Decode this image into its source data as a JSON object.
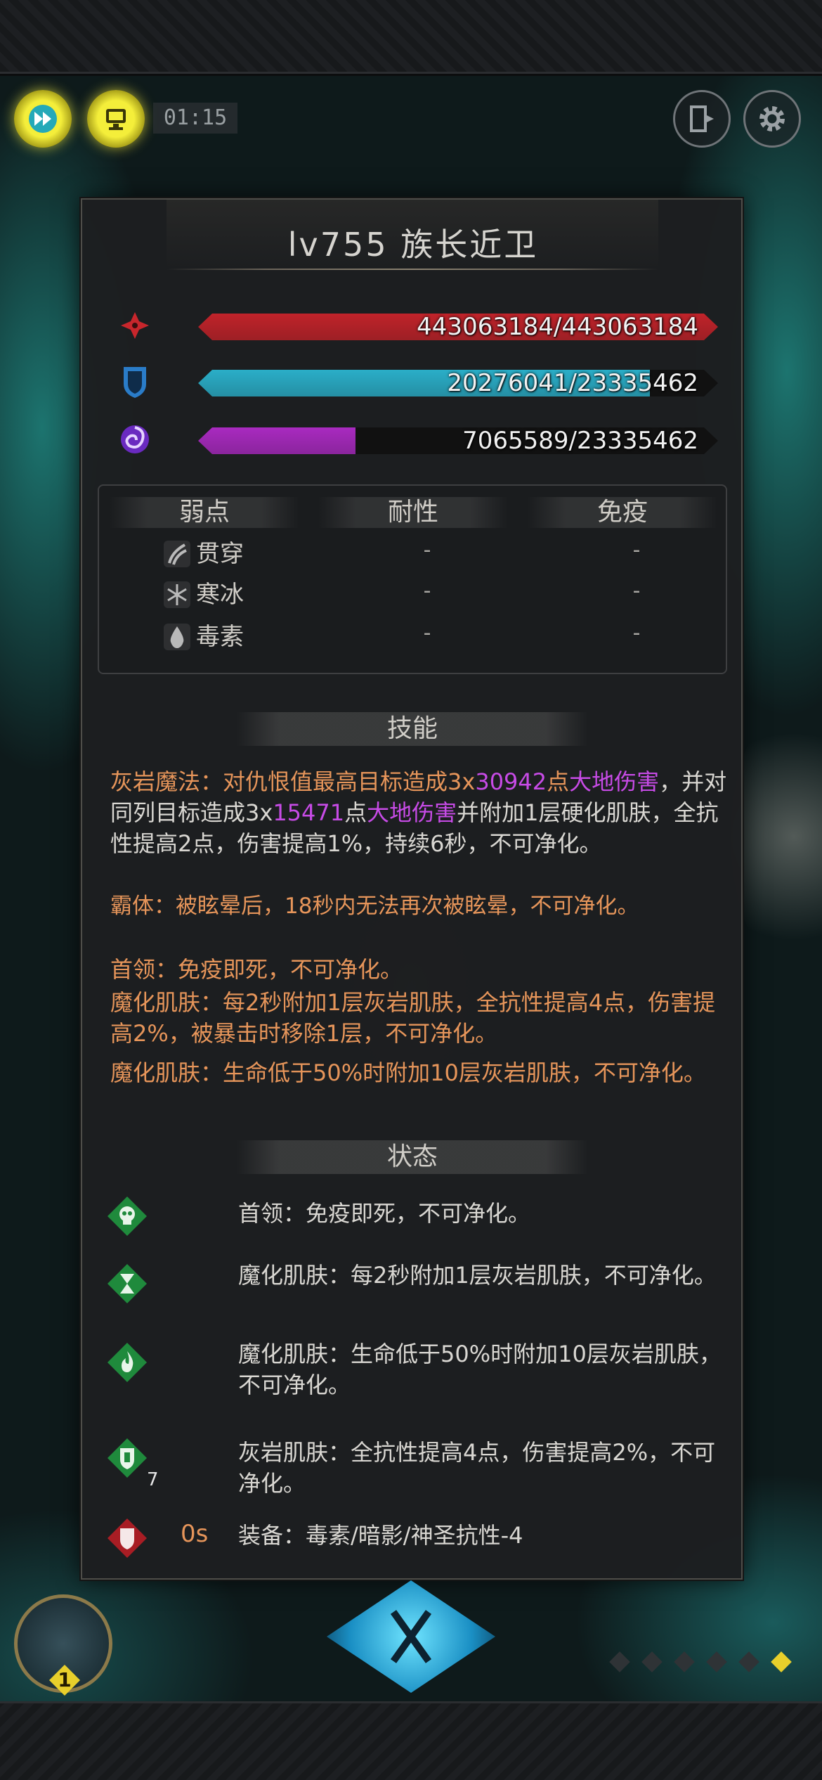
{
  "hud": {
    "timer": "01:15",
    "speed_icon": "fast-forward-icon",
    "auto_icon": "monitor-icon",
    "exit_icon": "exit-door-icon",
    "settings_icon": "gear-icon"
  },
  "monster": {
    "title": "lv755 族长近卫",
    "stats": [
      {
        "name": "health",
        "icon": "health-cross-icon",
        "text": "443063184/443063184",
        "fraction": 1.0,
        "color": "#c0232a"
      },
      {
        "name": "shield",
        "icon": "shield-icon",
        "text": "20276041/23335462",
        "fraction": 0.869,
        "color": "#2aaec8"
      },
      {
        "name": "energy",
        "icon": "swirl-energy-icon",
        "text": "7065589/23335462",
        "fraction": 0.303,
        "color": "#a92ac0"
      }
    ]
  },
  "resist_table": {
    "headers": [
      "弱点",
      "耐性",
      "免疫"
    ],
    "rows": [
      {
        "icon": "claw-pierce-icon",
        "name": "贯穿",
        "resist": "-",
        "immune": "-"
      },
      {
        "icon": "snowflake-icon",
        "name": "寒冰",
        "resist": "-",
        "immune": "-"
      },
      {
        "icon": "poison-drop-icon",
        "name": "毒素",
        "resist": "-",
        "immune": "-"
      }
    ]
  },
  "skills": {
    "header": "技能",
    "p1": {
      "a": "灰岩魔法：",
      "b": "对仇恨值最高目标造成3x",
      "c": "30942",
      "d": "点",
      "e": "大地伤害",
      "f": "，并对同列目标造成3x",
      "g": "15471",
      "h": "点",
      "i": "大地伤害",
      "j": "并附加1层硬化肌肤，全抗性提高2点，伤害提高1%，持续6秒，不可净化。"
    },
    "p2": "霸体：被眩晕后，18秒内无法再次被眩晕，不可净化。",
    "p3": "首领：免疫即死，不可净化。",
    "p4": "魔化肌肤：每2秒附加1层灰岩肌肤，全抗性提高4点，伤害提高2%，被暴击时移除1层，不可净化。",
    "p5": "魔化肌肤：生命低于50%时附加10层灰岩肌肤，不可净化。"
  },
  "status": {
    "header": "状态",
    "items": [
      {
        "icon": "skull-icon",
        "text": "首领：免疫即死，不可净化。"
      },
      {
        "icon": "hourglass-icon",
        "text": "魔化肌肤：每2秒附加1层灰岩肌肤，不可净化。"
      },
      {
        "icon": "flame-icon",
        "text": "魔化肌肤：生命低于50%时附加10层灰岩肌肤，不可净化。"
      },
      {
        "icon": "stone-shield-icon",
        "text": "灰岩肌肤：全抗性提高4点，伤害提高2%，不可净化。",
        "count": "7"
      },
      {
        "icon": "red-shield-icon",
        "duration": "0s",
        "text": "装备：毒素/暗影/神圣抗性-4"
      }
    ]
  },
  "bottom": {
    "hero_level": "1",
    "action_icon": "crossed-swords-icon"
  }
}
